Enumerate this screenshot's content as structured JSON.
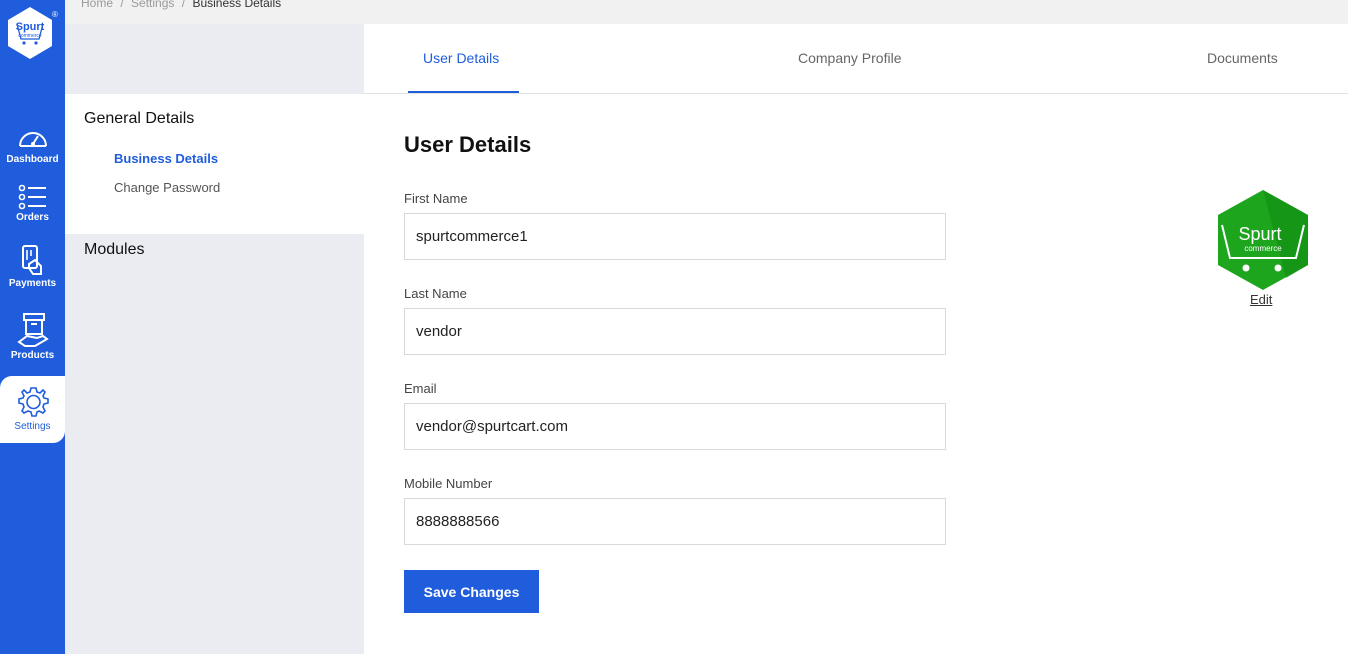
{
  "brand": {
    "logo_text": "Spurt",
    "logo_subtext": "commerce",
    "registered": "®"
  },
  "breadcrumb": {
    "home": "Home",
    "sep1": "/",
    "settings": "Settings",
    "sep2": "/",
    "current": "Business Details"
  },
  "rail": {
    "items": [
      {
        "label": "Dashboard",
        "icon": "gauge-icon"
      },
      {
        "label": "Orders",
        "icon": "list-icon"
      },
      {
        "label": "Payments",
        "icon": "payment-card-icon"
      },
      {
        "label": "Products",
        "icon": "box-hand-icon"
      },
      {
        "label": "Settings",
        "icon": "gear-icon",
        "active": true
      }
    ]
  },
  "subnav": {
    "general_heading": "General Details",
    "links": [
      {
        "label": "Business Details",
        "active": true
      },
      {
        "label": "Change Password",
        "active": false
      }
    ],
    "modules_heading": "Modules"
  },
  "tabs": [
    {
      "label": "User Details",
      "active": true
    },
    {
      "label": "Company Profile",
      "active": false
    },
    {
      "label": "Documents",
      "active": false
    }
  ],
  "form": {
    "title": "User Details",
    "first_name": {
      "label": "First Name",
      "value": "spurtcommerce1"
    },
    "last_name": {
      "label": "Last Name",
      "value": "vendor"
    },
    "email": {
      "label": "Email",
      "value": "vendor@spurtcart.com"
    },
    "mobile": {
      "label": "Mobile Number",
      "value": "8888888566"
    },
    "save_label": "Save Changes"
  },
  "avatar": {
    "text": "Spurt",
    "subtext": "commerce",
    "edit_label": "Edit"
  },
  "colors": {
    "primary": "#1f5ddc",
    "avatar_green": "#1ea51e",
    "panel": "#eaecf1"
  }
}
